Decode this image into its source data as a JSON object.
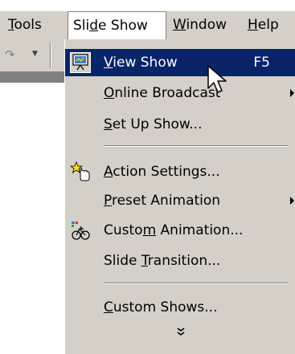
{
  "menubar": {
    "items": [
      {
        "pre": "",
        "key": "T",
        "post": "ools"
      },
      {
        "pre": "Sli",
        "key": "d",
        "post": "e Show"
      },
      {
        "pre": "",
        "key": "W",
        "post": "indow"
      },
      {
        "pre": "",
        "key": "H",
        "post": "elp"
      }
    ],
    "open_index": 1
  },
  "toolbar": {
    "redo_glyph": "↷",
    "dropdown_glyph": "▼"
  },
  "menu": {
    "items": [
      {
        "pre": "",
        "key": "V",
        "post": "iew Show",
        "shortcut": "F5",
        "icon": "view-show-icon",
        "highlighted": true
      },
      {
        "pre": "",
        "key": "O",
        "post": "nline Broadcast",
        "submenu": true
      },
      {
        "pre": "",
        "key": "S",
        "post": "et Up Show..."
      },
      {
        "pre": "",
        "key": "A",
        "post": "ction Settings...",
        "icon": "action-settings-icon"
      },
      {
        "pre": "",
        "key": "P",
        "post": "reset Animation",
        "submenu": true
      },
      {
        "pre": "Custo",
        "key": "m",
        "post": " Animation...",
        "icon": "custom-animation-icon"
      },
      {
        "pre": "Slide ",
        "key": "T",
        "post": "ransition..."
      },
      {
        "pre": "",
        "key": "C",
        "post": "ustom Shows..."
      }
    ],
    "expand_glyph": "⌄⌄"
  },
  "colors": {
    "menu_bg": "#d4d0c8",
    "highlight": "#0a246a",
    "highlight_text": "#ffffff"
  }
}
